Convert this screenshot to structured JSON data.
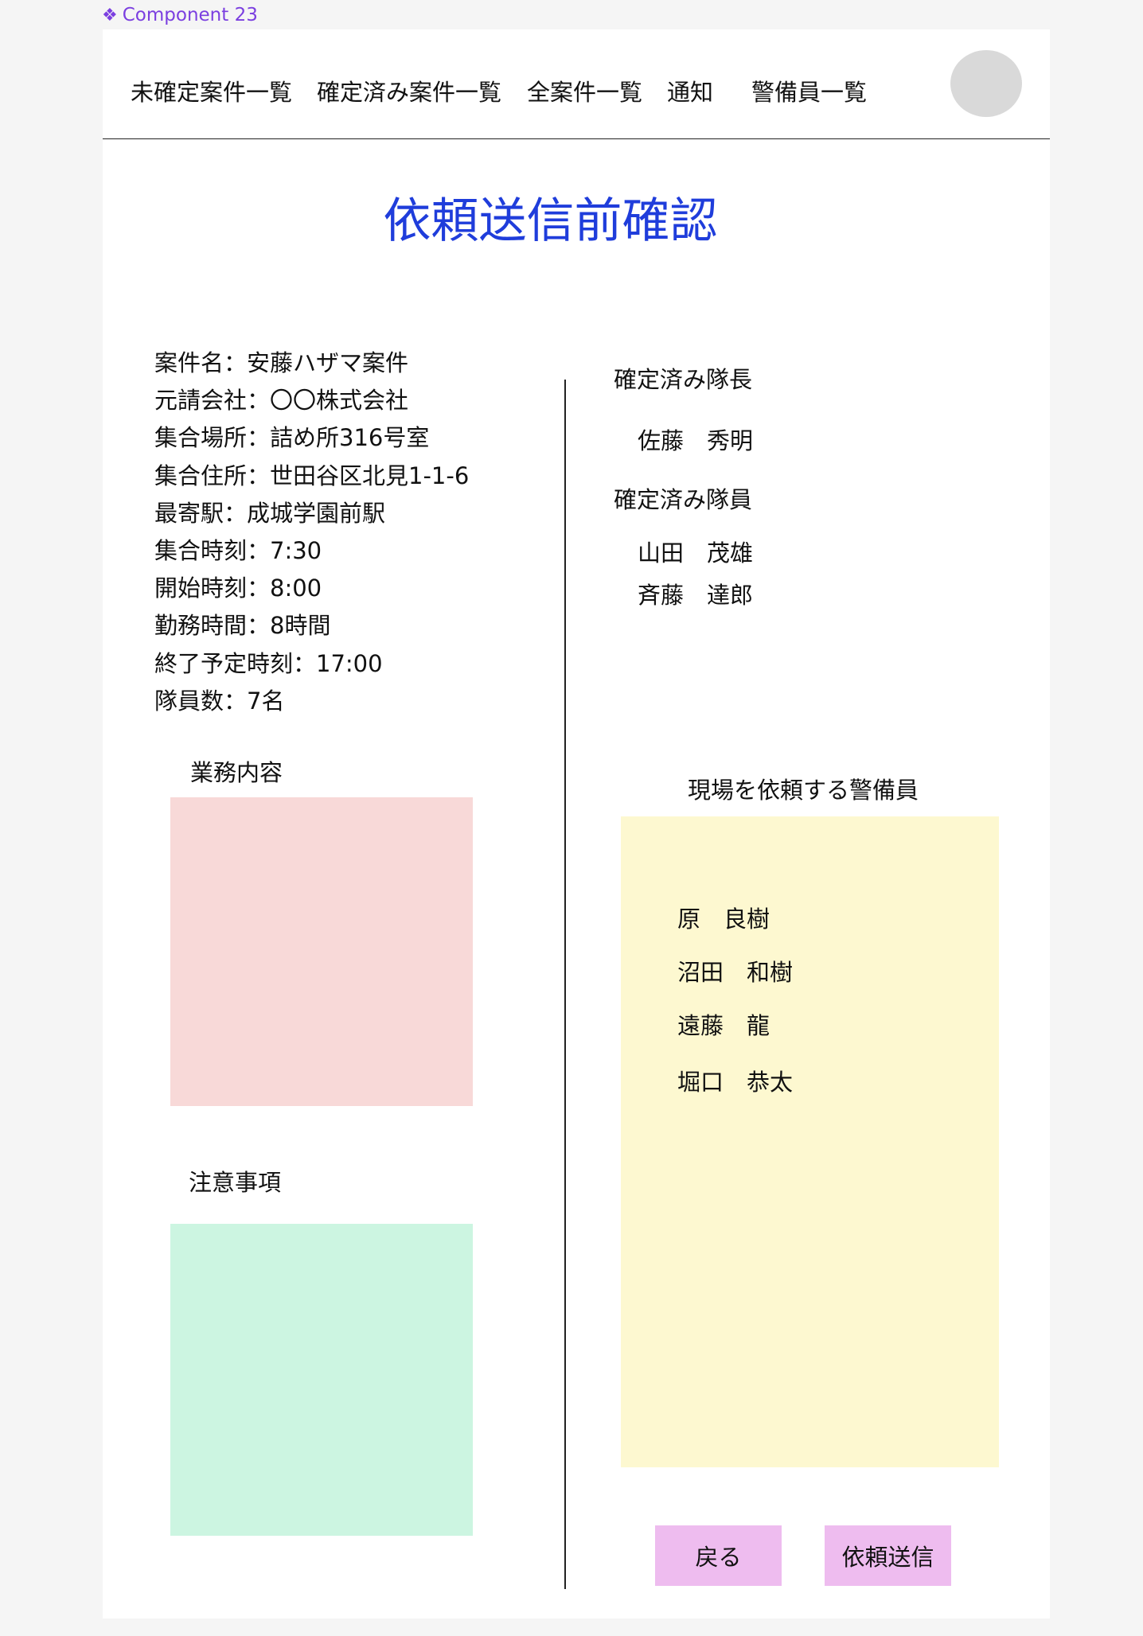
{
  "component": {
    "icon": "component-diamond-icon",
    "label": "Component 23"
  },
  "nav": {
    "items": [
      "未確定案件一覧",
      "確定済み案件一覧",
      "全案件一覧",
      "通知",
      "警備員一覧"
    ]
  },
  "title": "依頼送信前確認",
  "project": {
    "rows": [
      "案件名：安藤ハザマ案件",
      "元請会社：〇〇株式会社",
      "集合場所：詰め所316号室",
      "集合住所：世田谷区北見1-1-6",
      "最寄駅：成城学園前駅",
      "集合時刻：7:30",
      "開始時刻：8:00",
      "勤務時間：8時間",
      "終了予定時刻：17:00",
      "隊員数：7名"
    ],
    "work_content_label": "業務内容",
    "notes_label": "注意事項"
  },
  "confirmed": {
    "leader_label": "確定済み隊長",
    "leader": "佐藤　秀明",
    "members_label": "確定済み隊員",
    "members": [
      "山田　茂雄",
      "斉藤　達郎"
    ]
  },
  "request": {
    "label": "現場を依頼する警備員",
    "guards": [
      "原　良樹",
      "沼田　和樹",
      "遠藤　龍",
      "堀口　恭太"
    ]
  },
  "buttons": {
    "back": "戻る",
    "send": "依頼送信"
  },
  "colors": {
    "title": "#1f3ddb",
    "component_label": "#7b3fe0",
    "work_box": "#f8d9d8",
    "notes_box": "#ccf5e1",
    "guards_box": "#fdf8d0",
    "button": "#eebcef",
    "avatar": "#d9d9d9"
  }
}
